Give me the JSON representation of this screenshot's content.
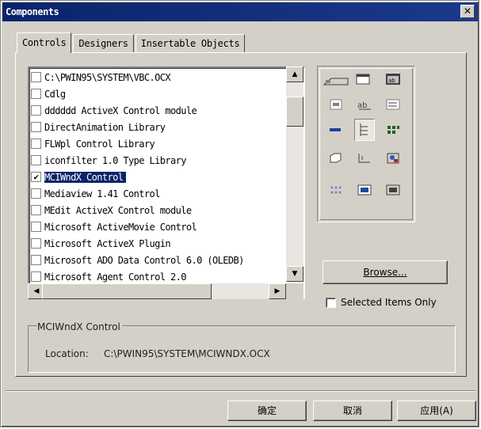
{
  "window": {
    "title": "Components",
    "close_symbol": "✕"
  },
  "tabs": [
    {
      "label": "Controls"
    },
    {
      "label": "Designers"
    },
    {
      "label": "Insertable Objects"
    }
  ],
  "controls_list": [
    {
      "label": "C:\\PWIN95\\SYSTEM\\VBC.OCX",
      "checked": false
    },
    {
      "label": "Cdlg",
      "checked": false
    },
    {
      "label": "dddddd ActiveX Control module",
      "checked": false
    },
    {
      "label": "DirectAnimation Library",
      "checked": false
    },
    {
      "label": "FLWpl Control Library",
      "checked": false
    },
    {
      "label": "iconfilter 1.0 Type Library",
      "checked": false
    },
    {
      "label": "MCIWndX Control",
      "checked": true
    },
    {
      "label": "Mediaview 1.41 Control",
      "checked": false
    },
    {
      "label": "MEdit ActiveX Control module",
      "checked": false
    },
    {
      "label": "Microsoft ActiveMovie Control",
      "checked": false
    },
    {
      "label": "Microsoft ActiveX Plugin",
      "checked": false
    },
    {
      "label": "Microsoft ADO Data Control 6.0 (OLEDB)",
      "checked": false
    },
    {
      "label": "Microsoft Agent Control 2.0",
      "checked": false
    }
  ],
  "selected_index": 6,
  "check_mark": "✔",
  "browse_label": "Browse...",
  "selected_only_label": "Selected Items Only",
  "details": {
    "title": "MCIWndX Control",
    "location_label": "Location:",
    "location_value": "C:\\PWIN95\\SYSTEM\\MCIWNDX.OCX"
  },
  "buttons": {
    "ok": "确定",
    "cancel": "取消",
    "apply": "应用(A)"
  },
  "colors": {
    "titlebar": "#0a246a",
    "selection": "#0a246a",
    "face": "#d4d0c8"
  }
}
